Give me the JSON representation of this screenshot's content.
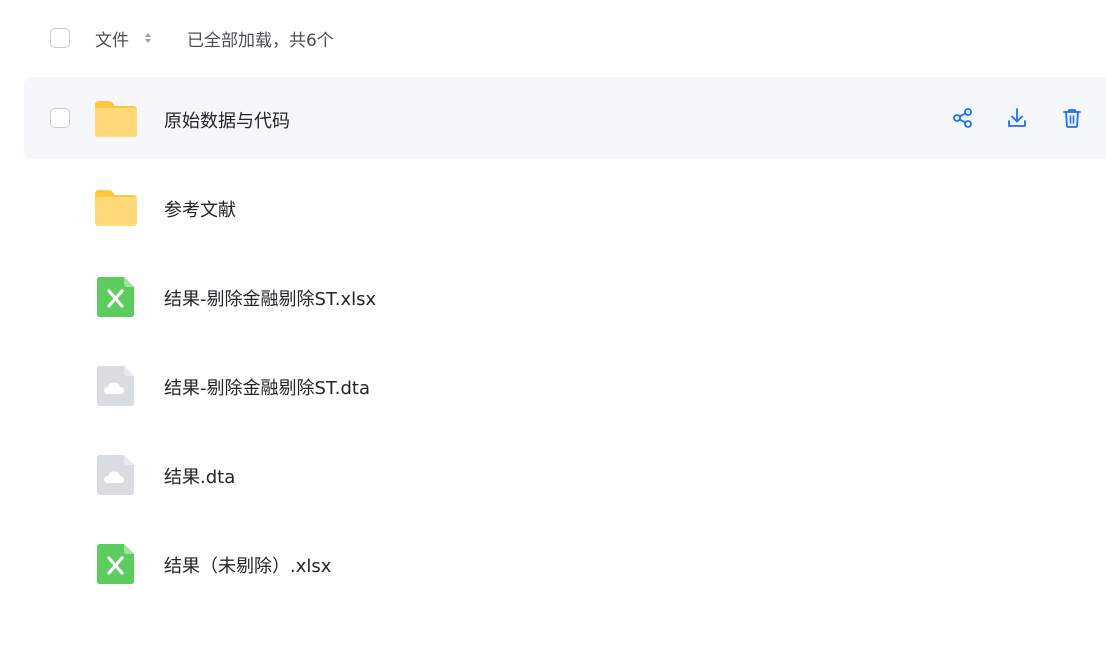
{
  "header": {
    "column_label": "文件",
    "status_text": "已全部加载，共6个"
  },
  "colors": {
    "accent": "#1f6eff",
    "folder": "#ffd26a",
    "excel": "#5dcc5f",
    "generic_file": "#d9dce1"
  },
  "files": [
    {
      "name": "原始数据与代码",
      "icon": "folder-icon"
    },
    {
      "name": "参考文献",
      "icon": "folder-icon"
    },
    {
      "name": "结果-剔除金融剔除ST.xlsx",
      "icon": "excel-file-icon"
    },
    {
      "name": "结果-剔除金融剔除ST.dta",
      "icon": "cloud-file-icon"
    },
    {
      "name": "结果.dta",
      "icon": "cloud-file-icon"
    },
    {
      "name": "结果（未剔除）.xlsx",
      "icon": "excel-file-icon"
    }
  ],
  "row_actions": [
    "share-icon",
    "download-icon",
    "delete-icon"
  ]
}
